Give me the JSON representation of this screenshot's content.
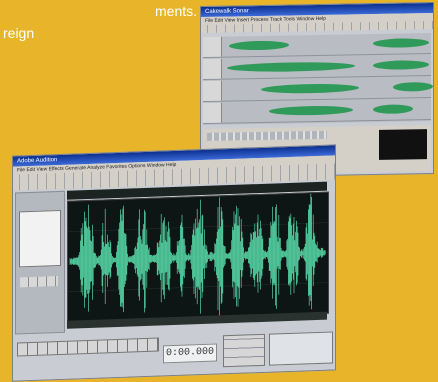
{
  "caption": {
    "line1": "ments.",
    "line2": "reign"
  },
  "back_window": {
    "title": "Cakewalk Sonar",
    "menu": "File  Edit  View  Insert  Process  Track  Tools  Window  Help",
    "track_count": 4,
    "wave_color": "#2f9a5a"
  },
  "front_window": {
    "title": "Adobe Audition",
    "menu": "File  Edit  View  Effects  Generate  Analyze  Favorites  Options  Window  Help",
    "time_display": "0:00.000",
    "waveform_color": "#56d6a6",
    "waveform_bg": "#0d1614"
  }
}
